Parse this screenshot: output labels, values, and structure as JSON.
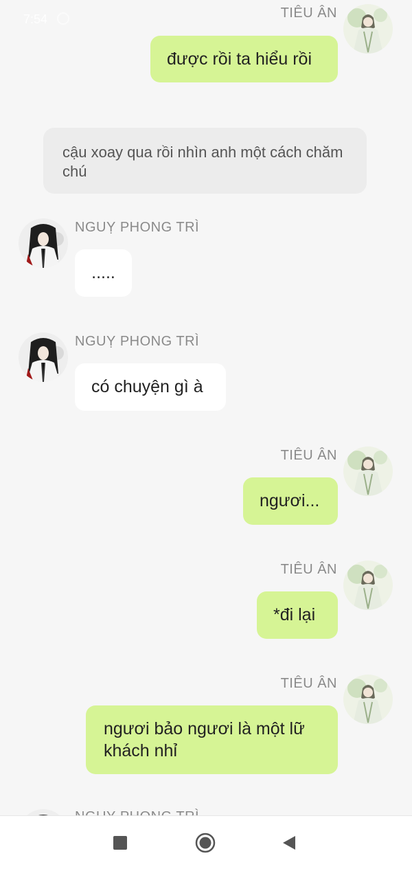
{
  "status_bar": {
    "time": "7:54"
  },
  "messages": [
    {
      "sender": "TIÊU ÂN",
      "text": "được rồi ta hiểu rồi"
    },
    {
      "narration": "cậu xoay qua rồi nhìn anh một cách chăm chú"
    },
    {
      "sender": "NGUỴ PHONG TRÌ",
      "text": "....."
    },
    {
      "sender": "NGUỴ PHONG TRÌ",
      "text": "có chuyện gì à"
    },
    {
      "sender": "TIÊU ÂN",
      "text": "ngươi..."
    },
    {
      "sender": "TIÊU ÂN",
      "text": "*đi lại"
    },
    {
      "sender": "TIÊU ÂN",
      "text": "ngươi bảo ngươi là một lữ khách nhỉ"
    },
    {
      "sender": "NGUỴ PHONG TRÌ"
    }
  ],
  "nav": {
    "recents_icon": "square-icon",
    "home_icon": "circle-icon",
    "back_icon": "triangle-back-icon"
  },
  "colors": {
    "green_bubble": "#d6f495",
    "white_bubble": "#ffffff",
    "narration_bg": "#ececec",
    "background": "#f6f6f6",
    "sender_name": "#8a8a8a"
  }
}
